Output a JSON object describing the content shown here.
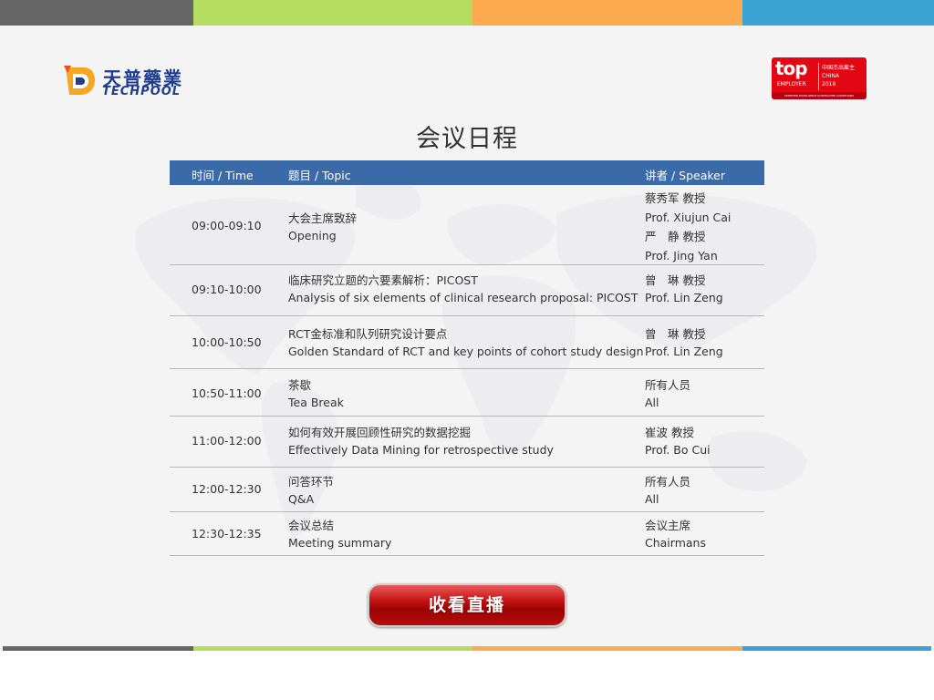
{
  "colors": {
    "stripe_gray": "#666666",
    "stripe_green": "#b5dc5e",
    "stripe_orange": "#fbab4d",
    "stripe_blue": "#3aa3d4",
    "header_blue": "#3a6aa8",
    "button_red": "#c81414",
    "brand_blue": "#1e3d8f",
    "badge_red": "#e30613"
  },
  "logo": {
    "chinese": "天普藥業",
    "english": "TECHPOOL",
    "icon": "techpool-logo-icon"
  },
  "badge": {
    "top": "top",
    "employer": "EMPLOYER",
    "cn_label": "中国杰出雇主",
    "country": "CHINA",
    "year": "2018",
    "footer": "CERTIFIED EXCELLENCE IN EMPLOYEE CONDITIONS"
  },
  "page": {
    "title": "会议日程"
  },
  "table": {
    "headers": {
      "time": "时间 / Time",
      "topic": "题目 / Topic",
      "speaker": "讲者 / Speaker"
    },
    "rows": [
      {
        "time": "09:00-09:10",
        "topic_cn": "大会主席致辞",
        "topic_en": "Opening",
        "speakers": [
          "蔡秀军 教授",
          "Prof. Xiujun Cai",
          "严　静 教授",
          "Prof. Jing Yan"
        ]
      },
      {
        "time": "09:10-10:00",
        "topic_cn": "临床研究立题的六要素解析：PICOST",
        "topic_en": "Analysis of six elements of clinical research proposal: PICOST",
        "speakers": [
          "曾　琳 教授",
          "Prof. Lin Zeng"
        ]
      },
      {
        "time": "10:00-10:50",
        "topic_cn": "RCT金标准和队列研究设计要点",
        "topic_en": "Golden Standard of RCT and key points of cohort study design",
        "speakers": [
          "曾　琳 教授",
          "Prof. Lin Zeng"
        ]
      },
      {
        "time": "10:50-11:00",
        "topic_cn": "茶歇",
        "topic_en": "Tea Break",
        "speakers": [
          "所有人员",
          "All"
        ]
      },
      {
        "time": "11:00-12:00",
        "topic_cn": "如何有效开展回顾性研究的数据挖掘",
        "topic_en": "Effectively Data Mining for retrospective study",
        "speakers": [
          "崔波 教授",
          "Prof. Bo Cui"
        ]
      },
      {
        "time": "12:00-12:30",
        "topic_cn": "问答环节",
        "topic_en": "Q&A",
        "speakers": [
          "所有人员",
          "All"
        ]
      },
      {
        "time": "12:30-12:35",
        "topic_cn": "会议总结",
        "topic_en": "Meeting summary",
        "speakers": [
          "会议主席",
          "Chairmans"
        ]
      }
    ]
  },
  "live_button": {
    "label": "收看直播"
  }
}
